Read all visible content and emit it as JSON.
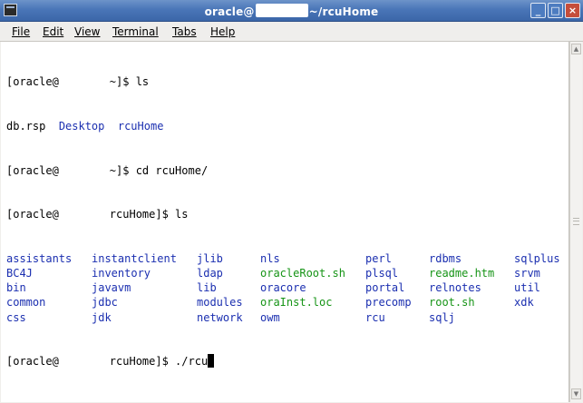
{
  "window": {
    "title_prefix": "oracle@",
    "title_suffix": "~/rcuHome",
    "buttons": {
      "minimize": "_",
      "maximize": "□",
      "close": "×"
    }
  },
  "menubar": [
    "File",
    "Edit",
    "View",
    "Terminal",
    "Tabs",
    "Help"
  ],
  "terminal": {
    "prompts": [
      {
        "prompt_start": "[oracle@",
        "prompt_end": "~]$ ls"
      },
      {
        "prompt_start": "[oracle@",
        "prompt_end": "~]$ cd rcuHome/"
      },
      {
        "prompt_start": "[oracle@",
        "prompt_end": "rcuHome]$ ls"
      },
      {
        "prompt_start": "[oracle@",
        "prompt_end": "rcuHome]$ ./rcu"
      }
    ],
    "ls_home": [
      {
        "name": "db.rsp",
        "color": "black"
      },
      {
        "name": "Desktop",
        "color": "blue"
      },
      {
        "name": "rcuHome",
        "color": "blue"
      }
    ],
    "ls_rcuhome": [
      [
        "assistants",
        "instantclient",
        "jlib",
        "nls",
        "perl",
        "rdbms",
        "sqlplus"
      ],
      [
        "BC4J",
        "inventory",
        "ldap",
        "oracleRoot.sh",
        "plsql",
        "readme.htm",
        "srvm"
      ],
      [
        "bin",
        "javavm",
        "lib",
        "oracore",
        "portal",
        "relnotes",
        "util"
      ],
      [
        "common",
        "jdbc",
        "modules",
        "oraInst.loc",
        "precomp",
        "root.sh",
        "xdk"
      ],
      [
        "css",
        "jdk",
        "network",
        "owm",
        "rcu",
        "sqlj",
        ""
      ]
    ],
    "ls_rcuhome_colors": [
      [
        "blue",
        "blue",
        "blue",
        "blue",
        "blue",
        "blue",
        "blue"
      ],
      [
        "blue",
        "blue",
        "blue",
        "green",
        "blue",
        "green",
        "blue"
      ],
      [
        "blue",
        "blue",
        "blue",
        "blue",
        "blue",
        "blue",
        "blue"
      ],
      [
        "blue",
        "blue",
        "blue",
        "green",
        "blue",
        "green",
        "blue"
      ],
      [
        "blue",
        "blue",
        "blue",
        "blue",
        "blue",
        "blue",
        ""
      ]
    ]
  },
  "colors": {
    "dir": "#1b2fb0",
    "exec": "#169416",
    "titlebar": "#4a76b8"
  }
}
